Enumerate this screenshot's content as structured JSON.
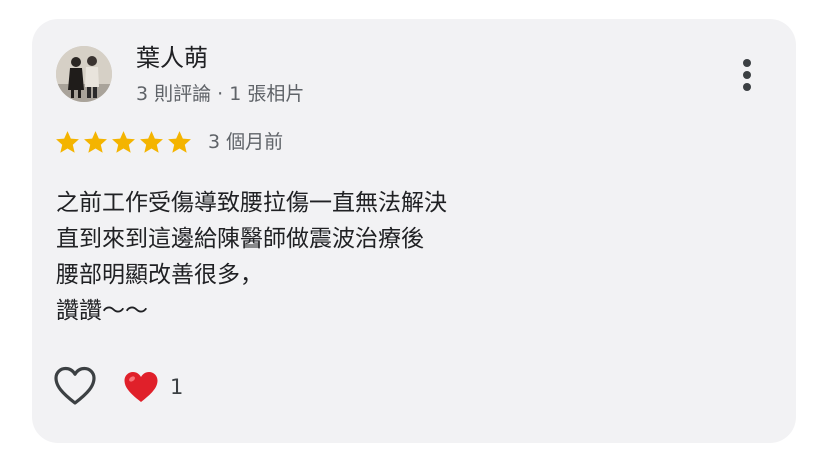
{
  "reviewer": {
    "name": "葉人萌",
    "meta": "3 則評論 · 1 張相片"
  },
  "rating": {
    "stars": 5,
    "max": 5,
    "time": "3 個月前"
  },
  "review": {
    "lines": [
      "之前工作受傷導致腰拉傷一直無法解決",
      "直到來到這邊給陳醫師做震波治療後",
      "腰部明顯改善很多，",
      "讚讚～～"
    ]
  },
  "reactions": {
    "like_icon": "heart-outline-icon",
    "reaction_icon": "red-heart-emoji",
    "count": "1"
  },
  "colors": {
    "card": "#f2f2f4",
    "star": "#f4b400",
    "heart": "#e0202a",
    "text": "#202124",
    "muted": "#5f6368"
  }
}
